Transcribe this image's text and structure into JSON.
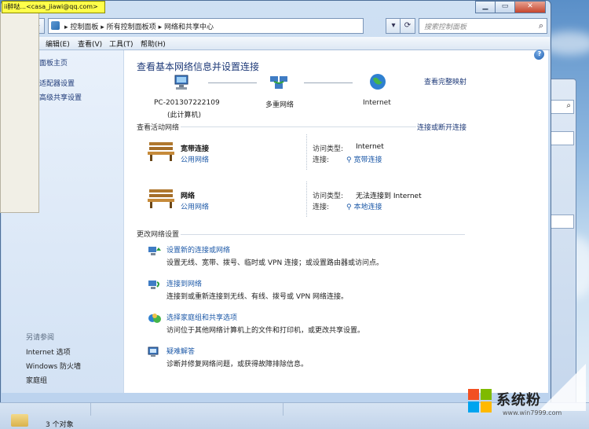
{
  "address": {
    "crumbs": [
      "控制面板",
      "所有控制面板项",
      "网络和共享中心"
    ],
    "search_placeholder": "搜索控制面板"
  },
  "menu": [
    "编辑(E)",
    "查看(V)",
    "工具(T)",
    "帮助(H)"
  ],
  "left_nav": {
    "items": [
      "面板主页",
      "适配器设置",
      "高级共享设置"
    ],
    "see_also_title": "另请参阅",
    "see_also": [
      "Internet 选项",
      "Windows 防火墙",
      "家庭组"
    ]
  },
  "content": {
    "title": "查看基本网络信息并设置连接",
    "full_map_link": "查看完整映射",
    "map": {
      "pc_name": "PC-201307222109",
      "pc_sub": "(此计算机)",
      "middle": "多重网络",
      "internet": "Internet"
    },
    "active_title": "查看活动网络",
    "connect_disconnect": "连接或断开连接",
    "networks": [
      {
        "name": "宽带连接",
        "type": "公用网络",
        "access_key": "访问类型:",
        "access_val": "Internet",
        "conn_key": "连接:",
        "conn_val": "宽带连接"
      },
      {
        "name": "网络",
        "type": "公用网络",
        "access_key": "访问类型:",
        "access_val": "无法连接到 Internet",
        "conn_key": "连接:",
        "conn_val": "本地连接"
      }
    ],
    "change_title": "更改网络设置",
    "tasks": [
      {
        "title": "设置新的连接或网络",
        "desc": "设置无线、宽带、拨号、临时或 VPN 连接；或设置路由器或访问点。"
      },
      {
        "title": "连接到网络",
        "desc": "连接到或重新连接到无线、有线、拨号或 VPN 网络连接。"
      },
      {
        "title": "选择家庭组和共享选项",
        "desc": "访问位于其他网络计算机上的文件和打印机，或更改共享设置。"
      },
      {
        "title": "疑难解答",
        "desc": "诊断并修复网络问题，或获得故障排除信息。"
      }
    ]
  },
  "status_bar": {
    "count_text": "3 个对象"
  },
  "tooltip": {
    "text": "ii醉哒...<casa_jiawi@qq.com>"
  },
  "watermark": {
    "brand": "系统粉",
    "url": "www.win7999.com"
  },
  "colors": {
    "link": "#1e5aa8",
    "title": "#1e3a78",
    "accent": "#2b6fb3"
  }
}
